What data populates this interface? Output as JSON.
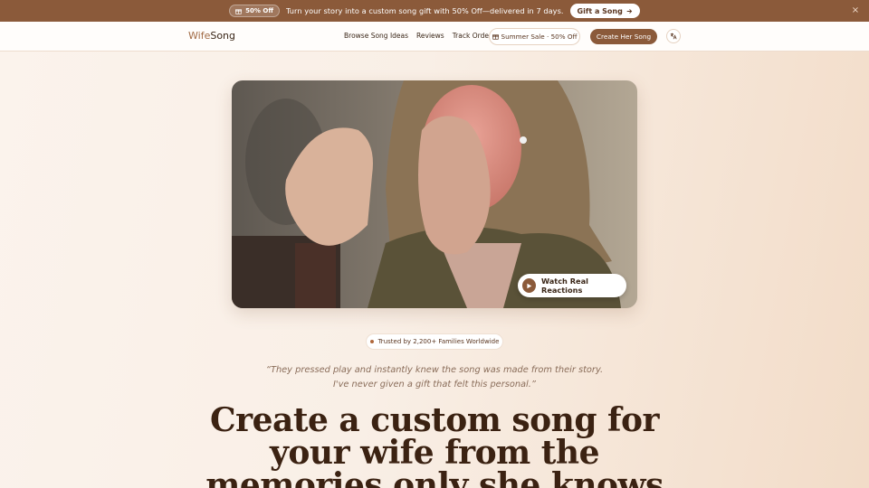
{
  "promo": {
    "badge": "50% Off",
    "text": "Turn your story into a custom song gift with 50% Off—delivered in 7 days.",
    "cta": "Gift a Song",
    "close": "×",
    "color": "#8b5a3a"
  },
  "header": {
    "logo_part1": "Wife",
    "logo_part2": "Song",
    "nav": [
      "Browse Song Ideas",
      "Reviews",
      "Track Order"
    ],
    "sale": "Summer Sale · 50% Off",
    "create": "Create Her Song",
    "lang_icon": "translate-icon"
  },
  "video": {
    "watch_label": "Watch Real Reactions"
  },
  "trust": "Trusted by 2,200+ Families Worldwide",
  "quote": "“They pressed play and instantly knew the song was made from their story. I've never given a gift that felt this personal.”",
  "headline": "Create a custom song for your wife from the memories only she knows",
  "colors": {
    "accent": "#8b5a3a",
    "text": "#3a2617",
    "background": "#f7ebe0"
  }
}
